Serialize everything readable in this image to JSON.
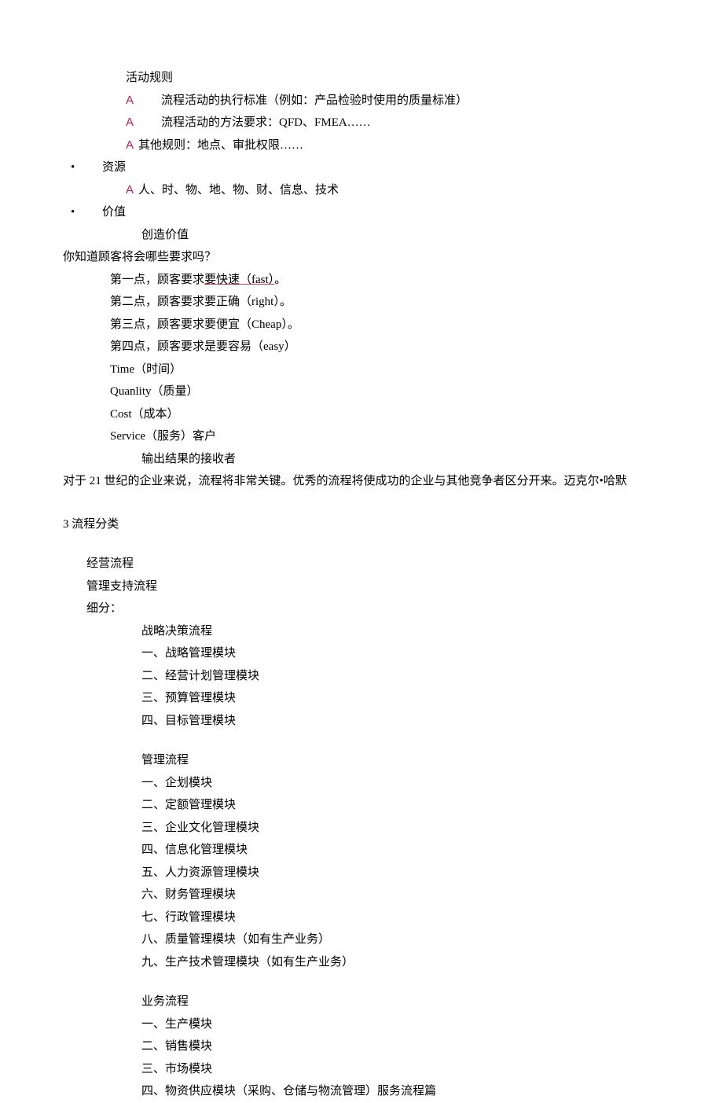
{
  "line1": "活动规则",
  "line2a": "A",
  "line2": "流程活动的执行标准（例如：产品检验时使用的质量标准）",
  "line3a": "A",
  "line3": "流程活动的方法要求：QFD、FMEA……",
  "line4a": "A",
  "line4": "其他规则：地点、审批权限……",
  "bullet1": "•",
  "line5": "资源",
  "line6a": "A",
  "line6": "人、时、物、地、物、财、信息、技术",
  "bullet2": "•",
  "line7": "价值",
  "line8": "创造价值",
  "line9": "你知道顾客将会哪些要求吗？",
  "line10_pre": "第一点，顾客要求",
  "line10_u": "要快速（fast）",
  "line10_post": "。",
  "line11": "第二点，顾客要求要正确（right）。",
  "line12": "第三点，顾客要求要便宜（Cheap）。",
  "line13": "第四点，顾客要求是要容易（easy）",
  "line14": "Time（时间）",
  "line15": "Quanlity（质量）",
  "line16": "Cost（成本）",
  "line17": "Service（服务）客户",
  "line18": "输出结果的接收者",
  "line19": "对于 21 世纪的企业来说，流程将非常关键。优秀的流程将使成功的企业与其他竞争者区分开来。迈克尔•哈默",
  "sec3": "3 流程分类",
  "p1": "经营流程",
  "p2": "管理支持流程",
  "p3": "细分：",
  "g1_title": "战略决策流程",
  "g1_1": "一、战略管理模块",
  "g1_2": "二、经营计划管理模块",
  "g1_3": "三、预算管理模块",
  "g1_4": "四、目标管理模块",
  "g2_title": "管理流程",
  "g2_1": "一、企划模块",
  "g2_2": "二、定额管理模块",
  "g2_3": "三、企业文化管理模块",
  "g2_4": "四、信息化管理模块",
  "g2_5": "五、人力资源管理模块",
  "g2_6": "六、财务管理模块",
  "g2_7": "七、行政管理模块",
  "g2_8": "八、质量管理模块（如有生产业务）",
  "g2_9": "九、生产技术管理模块（如有生产业务）",
  "g3_title": "业务流程",
  "g3_1": "一、生产模块",
  "g3_2": "二、销售模块",
  "g3_3": "三、市场模块",
  "g3_4": "四、物资供应模块（采购、仓储与物流管理）服务流程篇"
}
